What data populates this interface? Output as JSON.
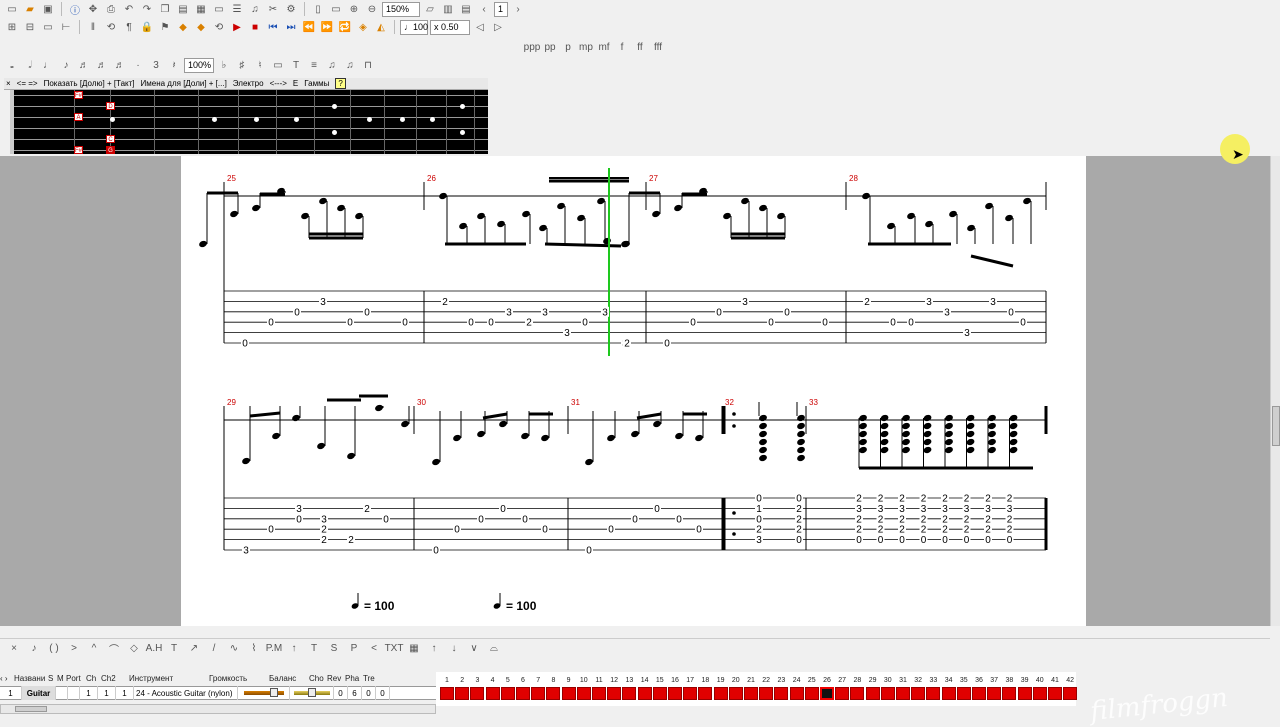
{
  "toolbar": {
    "zoom_value": "150%",
    "page_value": "1",
    "tempo_value": "♩ = 100",
    "speed_value": "x 0.50",
    "duration_label": "100%"
  },
  "fretboard": {
    "header": {
      "nav": "<=  =>",
      "show": "Показать [Долю] + [Такт]",
      "names": "Имена для [Доли] + [...]",
      "style": "Электро",
      "arrows": "<--->",
      "key": "E",
      "scales": "Гаммы",
      "help": "?"
    },
    "string_labels": [
      "G",
      "D"
    ],
    "notes": [
      {
        "label": "F#",
        "fret": 0,
        "string": 0,
        "fill": false
      },
      {
        "label": "D",
        "fret": 1,
        "string": 1,
        "fill": false
      },
      {
        "label": "A",
        "fret": 0,
        "string": 2,
        "fill": false
      },
      {
        "label": "C",
        "fret": 1,
        "string": 4,
        "fill": false
      },
      {
        "label": "F#",
        "fret": 0,
        "string": 5,
        "fill": false
      },
      {
        "label": "G",
        "fret": 1,
        "string": 5,
        "fill": true
      }
    ]
  },
  "score": {
    "measure_numbers_row1": [
      "25",
      "26",
      "27",
      "28"
    ],
    "measure_numbers_row2": [
      "29",
      "30",
      "31",
      "32",
      "33"
    ],
    "tab_row1": [
      {
        "m": 0,
        "notes": [
          [
            "0",
            5
          ],
          [
            "0",
            3
          ],
          [
            "0",
            2
          ],
          [
            "3",
            1
          ],
          [
            "0",
            3
          ],
          [
            "0",
            2
          ],
          [
            "0",
            3
          ]
        ]
      },
      {
        "m": 1,
        "notes": [
          [
            "2",
            1
          ],
          [
            "0",
            3
          ],
          [
            "0",
            3
          ],
          [
            "3",
            2
          ],
          [
            "2",
            3
          ],
          [
            "3",
            2
          ],
          [
            "3",
            4
          ],
          [
            "0",
            3
          ],
          [
            "3",
            2
          ],
          [
            "3",
            5
          ],
          [
            "2",
            5
          ]
        ]
      },
      {
        "m": 2,
        "notes": [
          [
            "0",
            5
          ],
          [
            "0",
            3
          ],
          [
            "0",
            2
          ],
          [
            "3",
            1
          ],
          [
            "0",
            3
          ],
          [
            "0",
            2
          ],
          [
            "0",
            3
          ]
        ]
      },
      {
        "m": 3,
        "notes": [
          [
            "2",
            1
          ],
          [
            "0",
            3
          ],
          [
            "0",
            3
          ],
          [
            "3",
            1
          ],
          [
            "3",
            2
          ],
          [
            "3",
            4
          ],
          [
            "3",
            1
          ],
          [
            "0",
            2
          ],
          [
            "0",
            3
          ]
        ]
      }
    ],
    "tab_row2": [
      {
        "m": 0,
        "notes": [
          [
            "3",
            5
          ],
          [
            "0",
            3
          ],
          [
            "3",
            1
          ],
          [
            "3",
            2
          ],
          [
            "2",
            1
          ],
          [
            "0",
            2
          ],
          [
            "2",
            3
          ],
          [
            "2",
            4
          ],
          [
            "2",
            4
          ],
          [
            "2",
            1
          ],
          [
            "0",
            2
          ]
        ]
      },
      {
        "m": 1,
        "notes": [
          [
            "0",
            5
          ],
          [
            "0",
            3
          ],
          [
            "0",
            2
          ],
          [
            "0",
            1
          ],
          [
            "0",
            2
          ],
          [
            "0",
            3
          ]
        ]
      },
      {
        "m": 2,
        "notes": [
          [
            "0",
            5
          ],
          [
            "0",
            3
          ],
          [
            "0",
            2
          ],
          [
            "0",
            1
          ],
          [
            "0",
            2
          ],
          [
            "0",
            3
          ]
        ]
      },
      {
        "m": 3,
        "chords": [
          [
            "0",
            "1",
            "0",
            "2",
            "3"
          ],
          [
            "0",
            "2",
            "2",
            "2",
            "0"
          ]
        ]
      },
      {
        "m": 4,
        "chords": [
          [
            "2",
            "3",
            "2",
            "2",
            "0"
          ],
          [
            "2",
            "3",
            "2",
            "2",
            "0"
          ],
          [
            "2",
            "3",
            "2",
            "2",
            "0"
          ],
          [
            "2",
            "3",
            "2",
            "2",
            "0"
          ],
          [
            "2",
            "3",
            "2",
            "2",
            "0"
          ],
          [
            "2",
            "3",
            "2",
            "2",
            "0"
          ],
          [
            "2",
            "3",
            "2",
            "2",
            "0"
          ],
          [
            "2",
            "3",
            "2",
            "2",
            "0"
          ]
        ]
      }
    ],
    "tempo_marks": [
      "= 100",
      "= 100"
    ]
  },
  "tracks": {
    "headers": [
      "Названи",
      "S",
      "M",
      "Port",
      "Ch",
      "Ch2",
      "Инструмент",
      "Громкость",
      "Баланс",
      "Cho",
      "Rev",
      "Pha",
      "Tre"
    ],
    "rows": [
      {
        "num": "1",
        "name": "Guitar",
        "port": "1",
        "ch": "1",
        "ch2": "1",
        "instrument": "24 - Acoustic Guitar (nylon)",
        "cho": "0",
        "rev": "6",
        "pha": "0",
        "tre": "0"
      }
    ]
  },
  "timeline": {
    "bar_numbers": [
      "1",
      "2",
      "3",
      "4",
      "5",
      "6",
      "7",
      "8",
      "9",
      "10",
      "11",
      "12",
      "13",
      "14",
      "15",
      "16",
      "17",
      "18",
      "19",
      "20",
      "21",
      "22",
      "23",
      "24",
      "25",
      "26",
      "27",
      "28",
      "29",
      "30",
      "31",
      "32",
      "33",
      "34",
      "35",
      "36",
      "37",
      "38",
      "39",
      "40",
      "41",
      "42"
    ],
    "current_bar": 26
  },
  "watermark": "filmfroggn"
}
